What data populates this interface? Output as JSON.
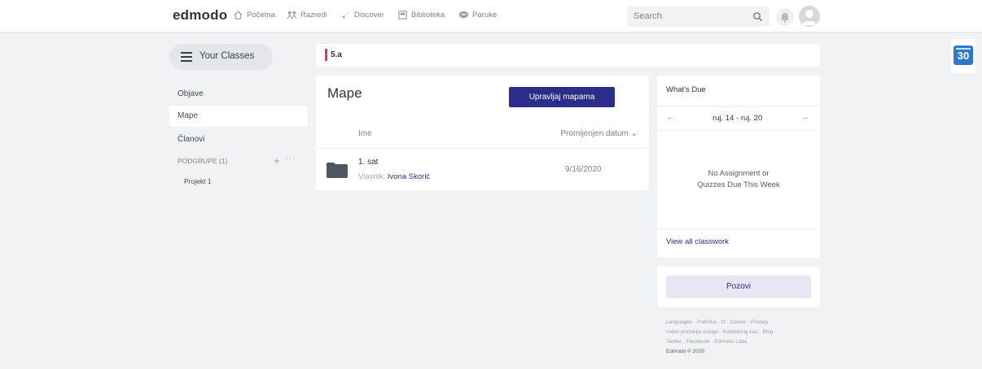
{
  "nav": {
    "logo": "edmodo",
    "items": [
      {
        "label": "Početna",
        "icon": "home-icon"
      },
      {
        "label": "Razredi",
        "icon": "classes-icon"
      },
      {
        "label": "Discover",
        "icon": "rocket-icon"
      },
      {
        "label": "Biblioteka",
        "icon": "library-icon"
      },
      {
        "label": "Poruke",
        "icon": "message-icon"
      }
    ],
    "search_placeholder": "Search"
  },
  "sidebar": {
    "your_classes": "Your Classes",
    "items": [
      {
        "label": "Objave",
        "active": false
      },
      {
        "label": "Mape",
        "active": true
      },
      {
        "label": "Članovi",
        "active": false
      }
    ],
    "subgroups_heading": "PODGRUPE (1)",
    "subgroups": [
      "Projekt 1"
    ]
  },
  "class_name": "5.a",
  "folders": {
    "title": "Mape",
    "manage_button": "Upravljaj mapama",
    "col_name": "Ime",
    "col_date": "Promijenjen datum ⌄",
    "rows": [
      {
        "name": "1. sat",
        "owner_label": "Vlasnik:",
        "owner": "Ivona Skorić",
        "date": "9/16/2020"
      }
    ]
  },
  "whats_due": {
    "title": "What's Due",
    "prev": "←",
    "range": "ruj. 14 - ruj. 20",
    "next": "→",
    "empty_line1": "No Assignment or",
    "empty_line2": "Quizzes Due This Week",
    "view_all": "View all classwork"
  },
  "invite_button": "Pozovi",
  "footer": {
    "line1": "Languages · Podrška · O · Career · Privacy ·",
    "line2": "Uvjeti pružanja usluge · Kontaktiraj nas · Blog ·",
    "line3": "Twitter · Facebook · Edmodo Labs",
    "copyright": "Edmodo © 2020"
  },
  "calendar_day": "30",
  "colors": {
    "accent": "#2a2e8a",
    "class_accent": "#e8336d",
    "calendar": "#2f78c6"
  }
}
